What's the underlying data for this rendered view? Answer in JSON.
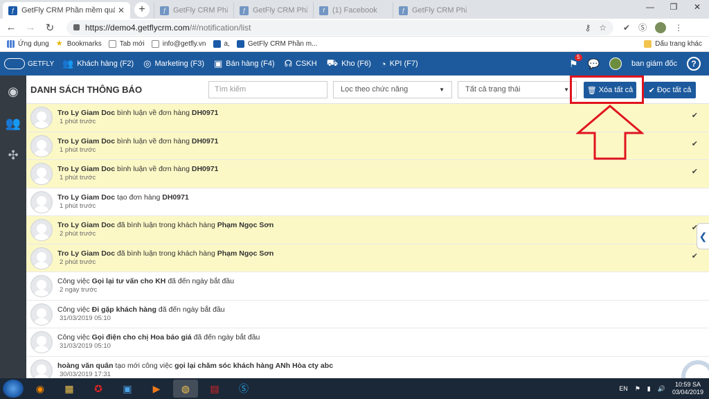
{
  "browser": {
    "active_tab": {
      "title": "GetFly CRM Phần mềm quản lý v"
    },
    "inactive_tabs": [
      "GetFly CRM Phần mềm quản lý",
      "GetFly CRM Phần mềm quản lý",
      "(1) Facebook",
      "GetFly CRM Phần mềm quản lý"
    ],
    "url_host": "https://demo4.getflycrm.com",
    "url_path": "/#/notification/list",
    "bookmarks": [
      "Ứng dụng",
      "Bookmarks",
      "Tab mới",
      "info@getfly.vn",
      "a,",
      "GetFly CRM Phần m..."
    ],
    "other_bookmarks": "Dấu trang khác"
  },
  "app": {
    "logo": "GETFLY",
    "menu": [
      "Khách hàng (F2)",
      "Marketing (F3)",
      "Bán hàng (F4)",
      "CSKH",
      "Kho (F6)",
      "KPI (F7)"
    ],
    "flag_badge": "5",
    "user": "ban giám đốc",
    "help": "?"
  },
  "page": {
    "title": "DANH SÁCH THÔNG BÁO",
    "search_placeholder": "Tìm kiếm",
    "filter_function": "Lọc theo chức năng",
    "filter_status": "Tất cả trạng thái",
    "delete_all": "Xóa tất cả",
    "read_all": "Đọc tất cả"
  },
  "notifications": [
    {
      "pre": "Tro Ly Giam Doc",
      "mid": " bình luận về đơn hàng ",
      "obj": "DH0971",
      "post": "",
      "time": "1 phút trước",
      "unread": true
    },
    {
      "pre": "Tro Ly Giam Doc",
      "mid": " bình luận về đơn hàng ",
      "obj": "DH0971",
      "post": "",
      "time": "1 phút trước",
      "unread": true
    },
    {
      "pre": "Tro Ly Giam Doc",
      "mid": " bình luận về đơn hàng ",
      "obj": "DH0971",
      "post": "",
      "time": "1 phút trước",
      "unread": true
    },
    {
      "pre": "Tro Ly Giam Doc",
      "mid": " tạo đơn hàng ",
      "obj": "DH0971",
      "post": "",
      "time": "1 phút trước",
      "unread": false
    },
    {
      "pre": "Tro Ly Giam Doc",
      "mid": " đã bình luận trong khách hàng ",
      "obj": "Phạm Ngọc Sơn",
      "post": "",
      "time": "2 phút trước",
      "unread": true
    },
    {
      "pre": "Tro Ly Giam Doc",
      "mid": " đã bình luận trong khách hàng ",
      "obj": "Phạm Ngọc Sơn",
      "post": "",
      "time": "2 phút trước",
      "unread": true
    },
    {
      "pre": "",
      "mid": "Công việc ",
      "obj": "Gọi lại tư vấn cho KH",
      "post": " đã đến ngày bắt đầu",
      "time": "2 ngày trước",
      "unread": false
    },
    {
      "pre": "",
      "mid": "Công việc ",
      "obj": "Đi gặp khách hàng",
      "post": " đã đến ngày bắt đầu",
      "time": "31/03/2019 05:10",
      "unread": false
    },
    {
      "pre": "",
      "mid": "Công việc ",
      "obj": "Gọi điện cho chị Hoa báo giá",
      "post": " đã đến ngày bắt đầu",
      "time": "31/03/2019 05:10",
      "unread": false
    },
    {
      "pre": "hoàng văn quân",
      "mid": " tạo mới công việc ",
      "obj": "gọi lại chăm sóc khách hàng ANh Hòa cty abc",
      "post": "",
      "time": "30/03/2019 17:31",
      "unread": false
    }
  ],
  "taskbar": {
    "lang": "EN",
    "time": "10:59 SA",
    "date": "03/04/2019"
  },
  "colors": {
    "brand": "#1d5a9d",
    "unread_bg": "#fcf8c6",
    "highlight": "#e0141e"
  }
}
